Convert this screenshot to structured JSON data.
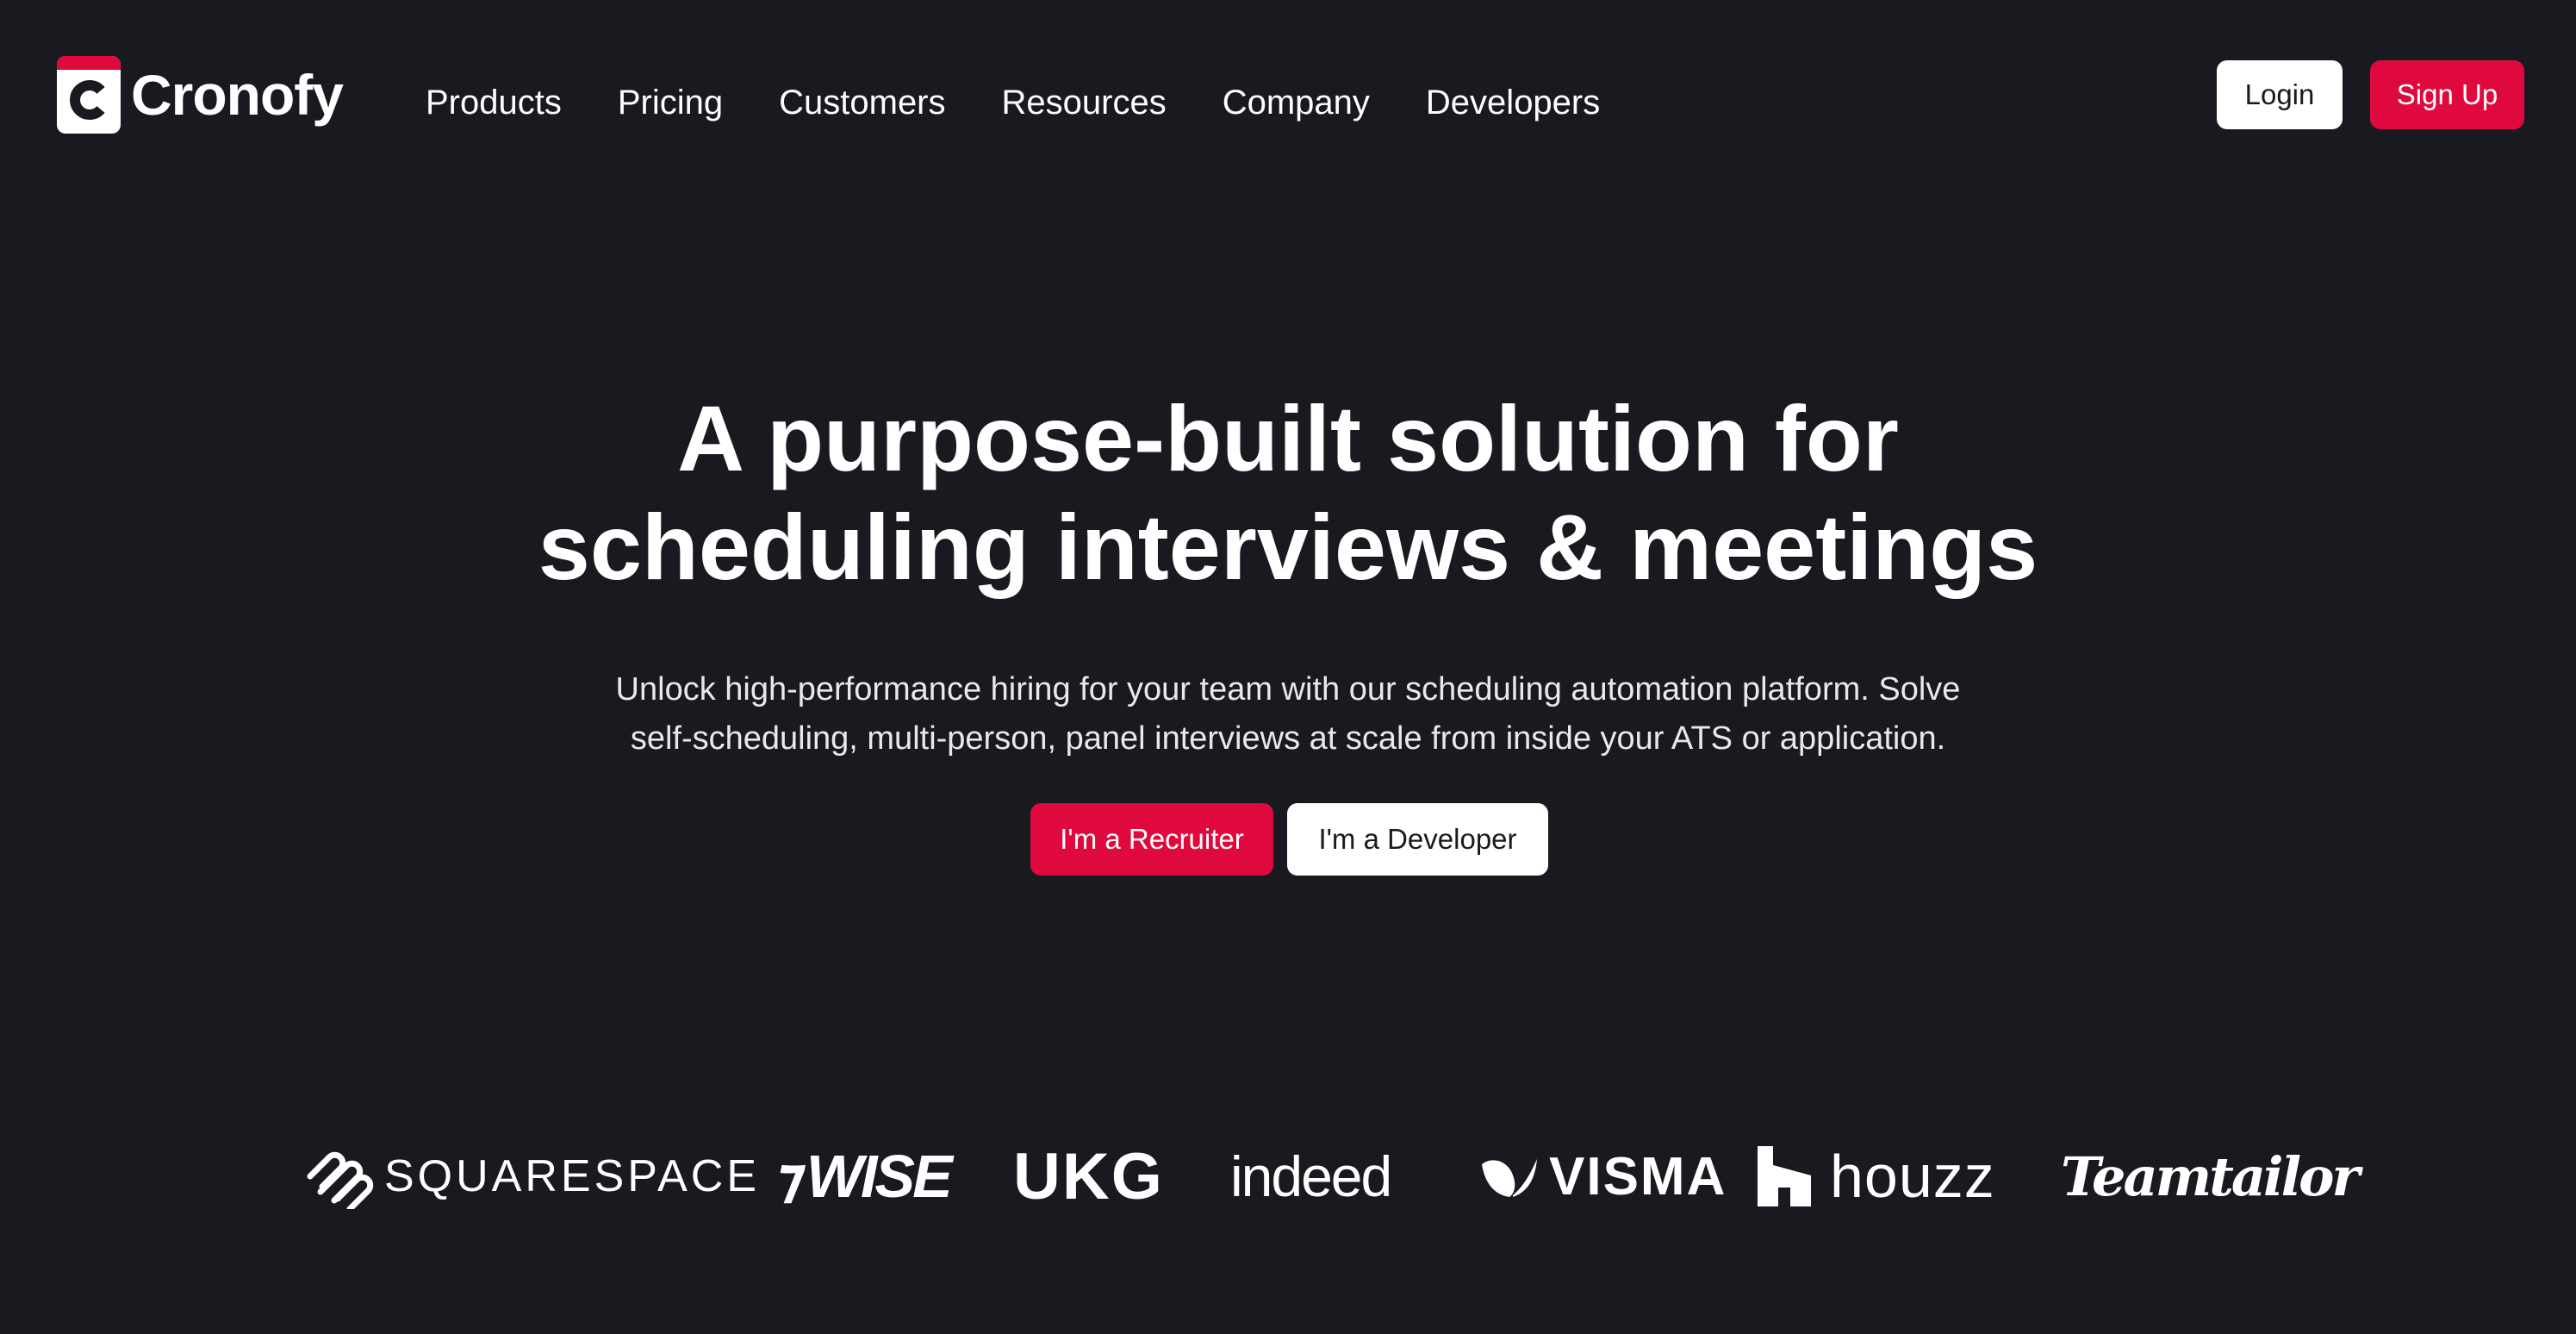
{
  "header": {
    "logo_text": "Cronofy",
    "logo_icon": "cronofy-c-icon",
    "nav": [
      {
        "label": "Products"
      },
      {
        "label": "Pricing"
      },
      {
        "label": "Customers"
      },
      {
        "label": "Resources"
      },
      {
        "label": "Company"
      },
      {
        "label": "Developers"
      }
    ],
    "login_label": "Login",
    "signup_label": "Sign Up"
  },
  "hero": {
    "title_line1": "A purpose-built solution for",
    "title_line2": "scheduling interviews & meetings",
    "subtitle_line1": "Unlock high-performance hiring for your team with our scheduling automation platform. Solve",
    "subtitle_line2": "self-scheduling, multi-person, panel interviews at scale from inside your ATS or application.",
    "recruiter_label": "I'm a Recruiter",
    "developer_label": "I'm a Developer"
  },
  "customer_logos": [
    {
      "name": "SQUARESPACE",
      "icon": "squarespace-icon"
    },
    {
      "name": "WISE",
      "icon": "wise-flag-icon"
    },
    {
      "name": "UKG",
      "icon": ""
    },
    {
      "name": "indeed",
      "icon": ""
    },
    {
      "name": "VISMA",
      "icon": "visma-icon"
    },
    {
      "name": "houzz",
      "icon": "houzz-house-icon"
    },
    {
      "name": "Teamtailor",
      "icon": ""
    }
  ],
  "colors": {
    "background": "#181a1f",
    "accent": "#e0093d",
    "text": "#ffffff"
  }
}
